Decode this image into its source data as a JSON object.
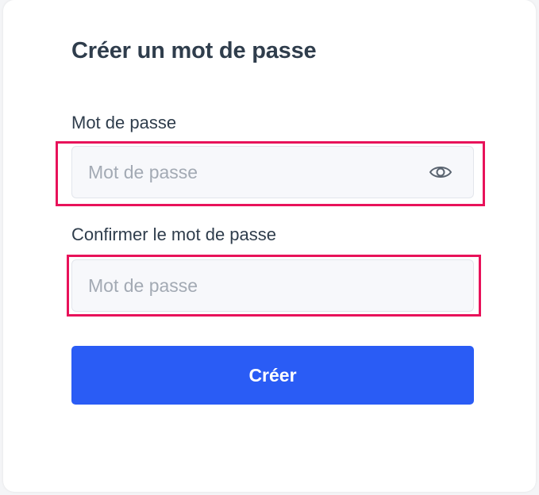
{
  "form": {
    "title": "Créer un mot de passe",
    "password": {
      "label": "Mot de passe",
      "placeholder": "Mot de passe",
      "value": ""
    },
    "confirm_password": {
      "label": "Confirmer le mot de passe",
      "placeholder": "Mot de passe",
      "value": ""
    },
    "submit_label": "Créer"
  },
  "icons": {
    "password_visibility": "eye-icon"
  },
  "colors": {
    "primary_button": "#2a5cf5",
    "highlight_border": "#e8125a",
    "title_text": "#2f3d4c",
    "placeholder_text": "#a3aab4"
  }
}
